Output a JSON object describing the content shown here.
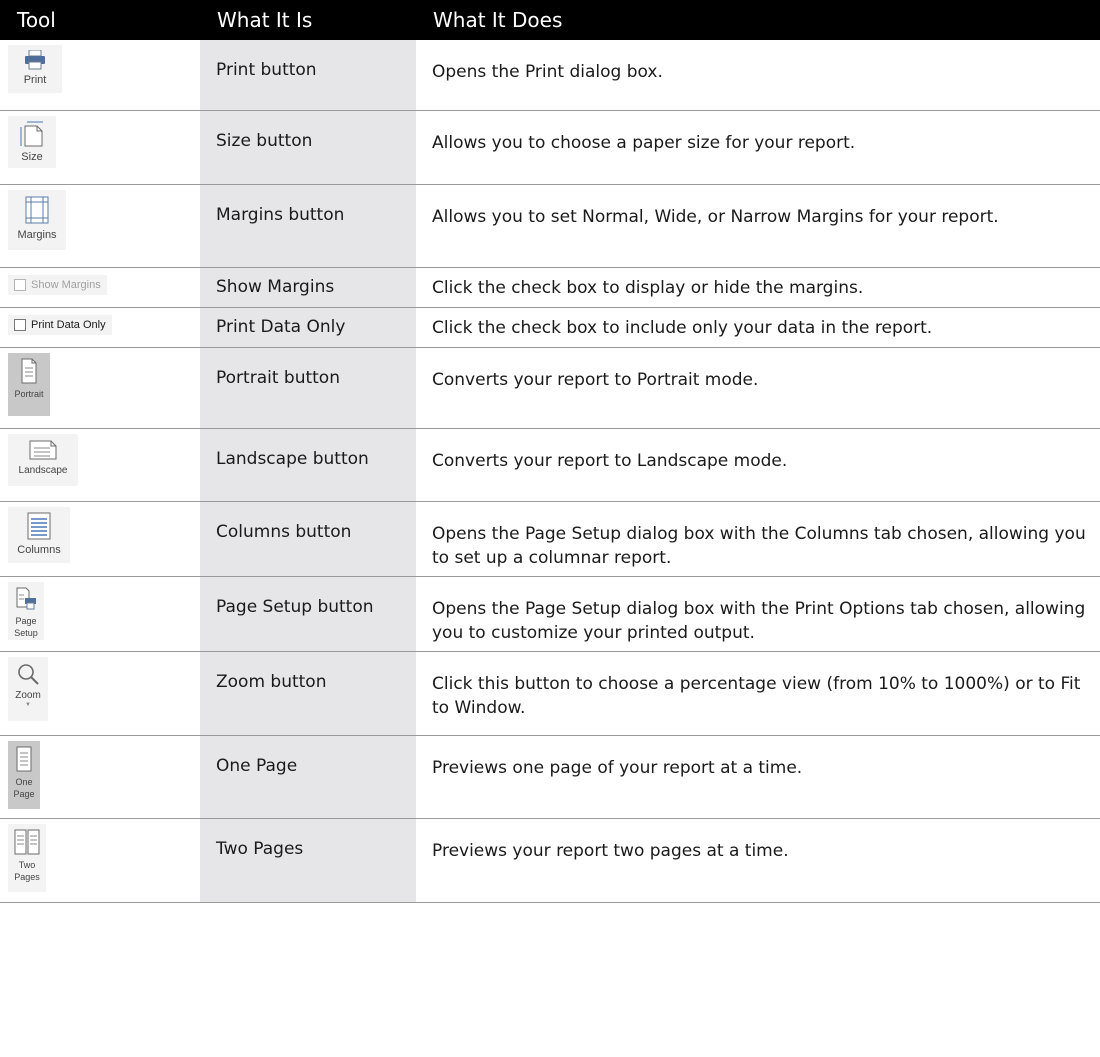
{
  "headers": {
    "tool": "Tool",
    "what": "What It Is",
    "does": "What It Does"
  },
  "rows": [
    {
      "tool_label": "Print",
      "what": "Print button",
      "does": "Opens the Print dialog box."
    },
    {
      "tool_label": "Size",
      "what": "Size button",
      "does": "Allows you to choose a paper size for your report."
    },
    {
      "tool_label": "Margins",
      "what": "Margins button",
      "does": "Allows you to set Normal, Wide, or Narrow Margins for your report."
    },
    {
      "tool_label": "Show Margins",
      "what": "Show Margins",
      "does": "Click the check box to display or hide the margins."
    },
    {
      "tool_label": "Print Data Only",
      "what": "Print Data Only",
      "does": "Click the check box to include only your data in the report."
    },
    {
      "tool_label": "Portrait",
      "what": "Portrait button",
      "does": "Converts your report to Portrait mode."
    },
    {
      "tool_label": "Landscape",
      "what": "Landscape button",
      "does": "Converts your report to Landscape mode."
    },
    {
      "tool_label": "Columns",
      "what": "Columns button",
      "does": "Opens the Page Setup dialog box with the Columns tab chosen, allowing you to set up a columnar report."
    },
    {
      "tool_label_1": "Page",
      "tool_label_2": "Setup",
      "what": "Page Setup button",
      "does": "Opens the Page Setup dialog box with the Print Options tab chosen, allowing you to customize your printed output."
    },
    {
      "tool_label": "Zoom",
      "what": "Zoom button",
      "does": "Click this button to choose a percentage view (from 10% to 1000%) or to Fit to Window."
    },
    {
      "tool_label_1": "One",
      "tool_label_2": "Page",
      "what": "One Page",
      "does": "Previews one page of your report at a time."
    },
    {
      "tool_label_1": "Two",
      "tool_label_2": "Pages",
      "what": "Two Pages",
      "does": "Previews your report two pages at a time."
    }
  ]
}
